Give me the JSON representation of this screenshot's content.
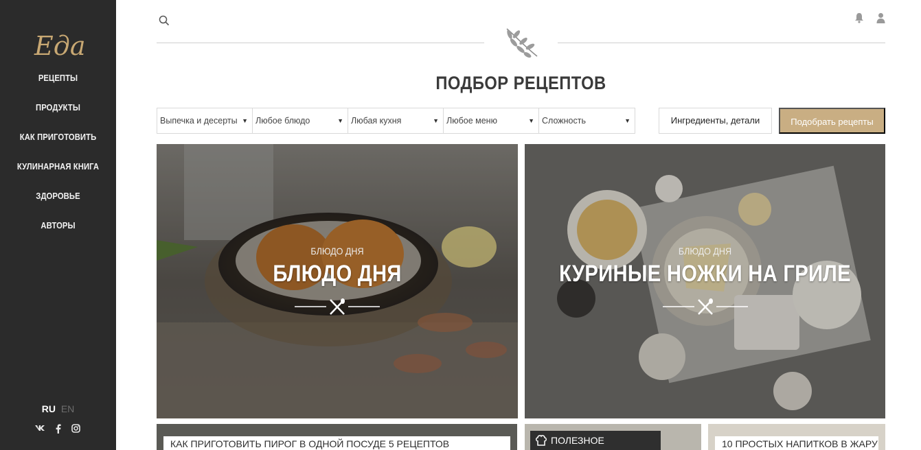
{
  "sidebar": {
    "logo": "Еда",
    "nav": [
      "РЕЦЕПТЫ",
      "ПРОДУКТЫ",
      "КАК ПРИГОТОВИТЬ",
      "КУЛИНАРНАЯ КНИГА",
      "ЗДОРОВЬЕ",
      "АВТОРЫ"
    ],
    "lang_active": "RU",
    "lang_inactive": "EN",
    "social": [
      "vk-icon",
      "facebook-icon",
      "instagram-icon"
    ]
  },
  "header": {
    "search_icon": "search-icon",
    "bell_icon": "bell-icon",
    "user_icon": "user-icon",
    "emblem_icon": "branch-icon"
  },
  "picker": {
    "title": "ПОДБОР РЕЦЕПТОВ",
    "filters": [
      "Выпечка и десерты",
      "Любое блюдо",
      "Любая кухня",
      "Любое меню",
      "Сложность"
    ],
    "details_button": "Ингредиенты, детали",
    "submit_button": "Подобрать рецепты"
  },
  "cards": [
    {
      "kicker": "БЛЮДО ДНЯ",
      "headline": "БЛЮДО ДНЯ"
    },
    {
      "kicker": "БЛЮДО ДНЯ",
      "headline": "КУРИНЫЕ НОЖКИ НА ГРИЛЕ"
    }
  ],
  "teasers": {
    "first": "КАК ПРИГОТОВИТЬ ПИРОГ В ОДНОЙ ПОСУДЕ 5 РЕЦЕПТОВ",
    "useful": "ПОЛЕЗНОЕ",
    "third": "10 ПРОСТЫХ НАПИТКОВ В ЖАРУ"
  },
  "colors": {
    "sidebar_bg": "#2b2b2b",
    "accent_gold": "#c9ae83",
    "logo_gold": "#c8a873"
  }
}
